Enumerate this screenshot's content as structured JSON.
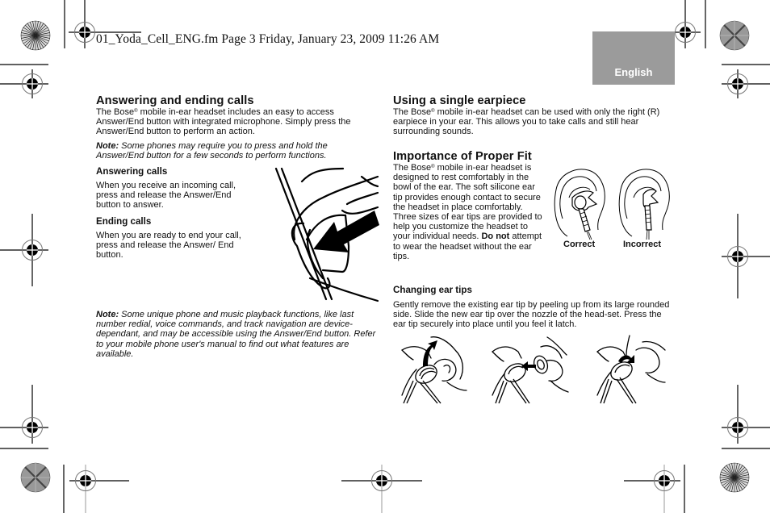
{
  "slug_line": "01_Yoda_Cell_ENG.fm  Page 3  Friday, January 23, 2009  11:26 AM",
  "language_tab": {
    "label": "English",
    "color": "#9b9b9b"
  },
  "left_column": {
    "answering_ending": {
      "heading": "Answering and ending calls",
      "body_prefix": "The Bose",
      "body_reg": "®",
      "body_rest": " mobile in-ear headset includes an easy to access Answer/End button with integrated microphone. Simply press the Answer/End button to perform an action.",
      "note_label": "Note:",
      "note_text": " Some phones may require you to press and hold the Answer/End button for a few seconds to perform functions."
    },
    "answering_calls": {
      "heading": "Answering calls",
      "body": "When you receive an incoming call, press and release the Answer/End button to answer."
    },
    "ending_calls": {
      "heading": "Ending calls",
      "body": "When you are ready to end your call, press and release the Answer/ End button."
    },
    "illustration": "press-answer-end-button-illustration",
    "bottom_note": {
      "label": "Note:",
      "text": " Some unique phone and music playback functions, like last number redial, voice commands, and track navigation are device-dependant, and may be accessible using the Answer/End button. Refer to your mobile phone user's manual to find out what features are available."
    }
  },
  "right_column": {
    "single_earpiece": {
      "heading": "Using a single earpiece",
      "body_prefix": "The Bose",
      "body_reg": "®",
      "body_rest": " mobile in-ear headset can be used with only the right (R) earpiece in your ear. This allows you to take calls and still hear surrounding sounds."
    },
    "proper_fit": {
      "heading": "Importance of Proper Fit",
      "body_prefix": "The Bose",
      "body_reg": "®",
      "body_mid": " mobile in-ear headset is designed to rest comfortably in the bowl of the ear. The soft silicone ear tip provides enough contact to secure the headset in place comfortably. Three sizes of ear tips are provided to help you customize the headset to your individual needs. ",
      "body_bold": "Do not",
      "body_end": " attempt to wear the headset without the ear tips.",
      "captions": {
        "correct": "Correct",
        "incorrect": "Incorrect"
      }
    },
    "changing_tips": {
      "heading": "Changing ear tips",
      "body": "Gently remove the existing ear tip by peeling up from its large rounded side. Slide the new ear tip over the nozzle of the head-set. Press the ear tip securely into place until you feel it latch.",
      "steps": [
        "remove-ear-tip",
        "slide-new-ear-tip",
        "press-ear-tip-latch"
      ]
    }
  }
}
